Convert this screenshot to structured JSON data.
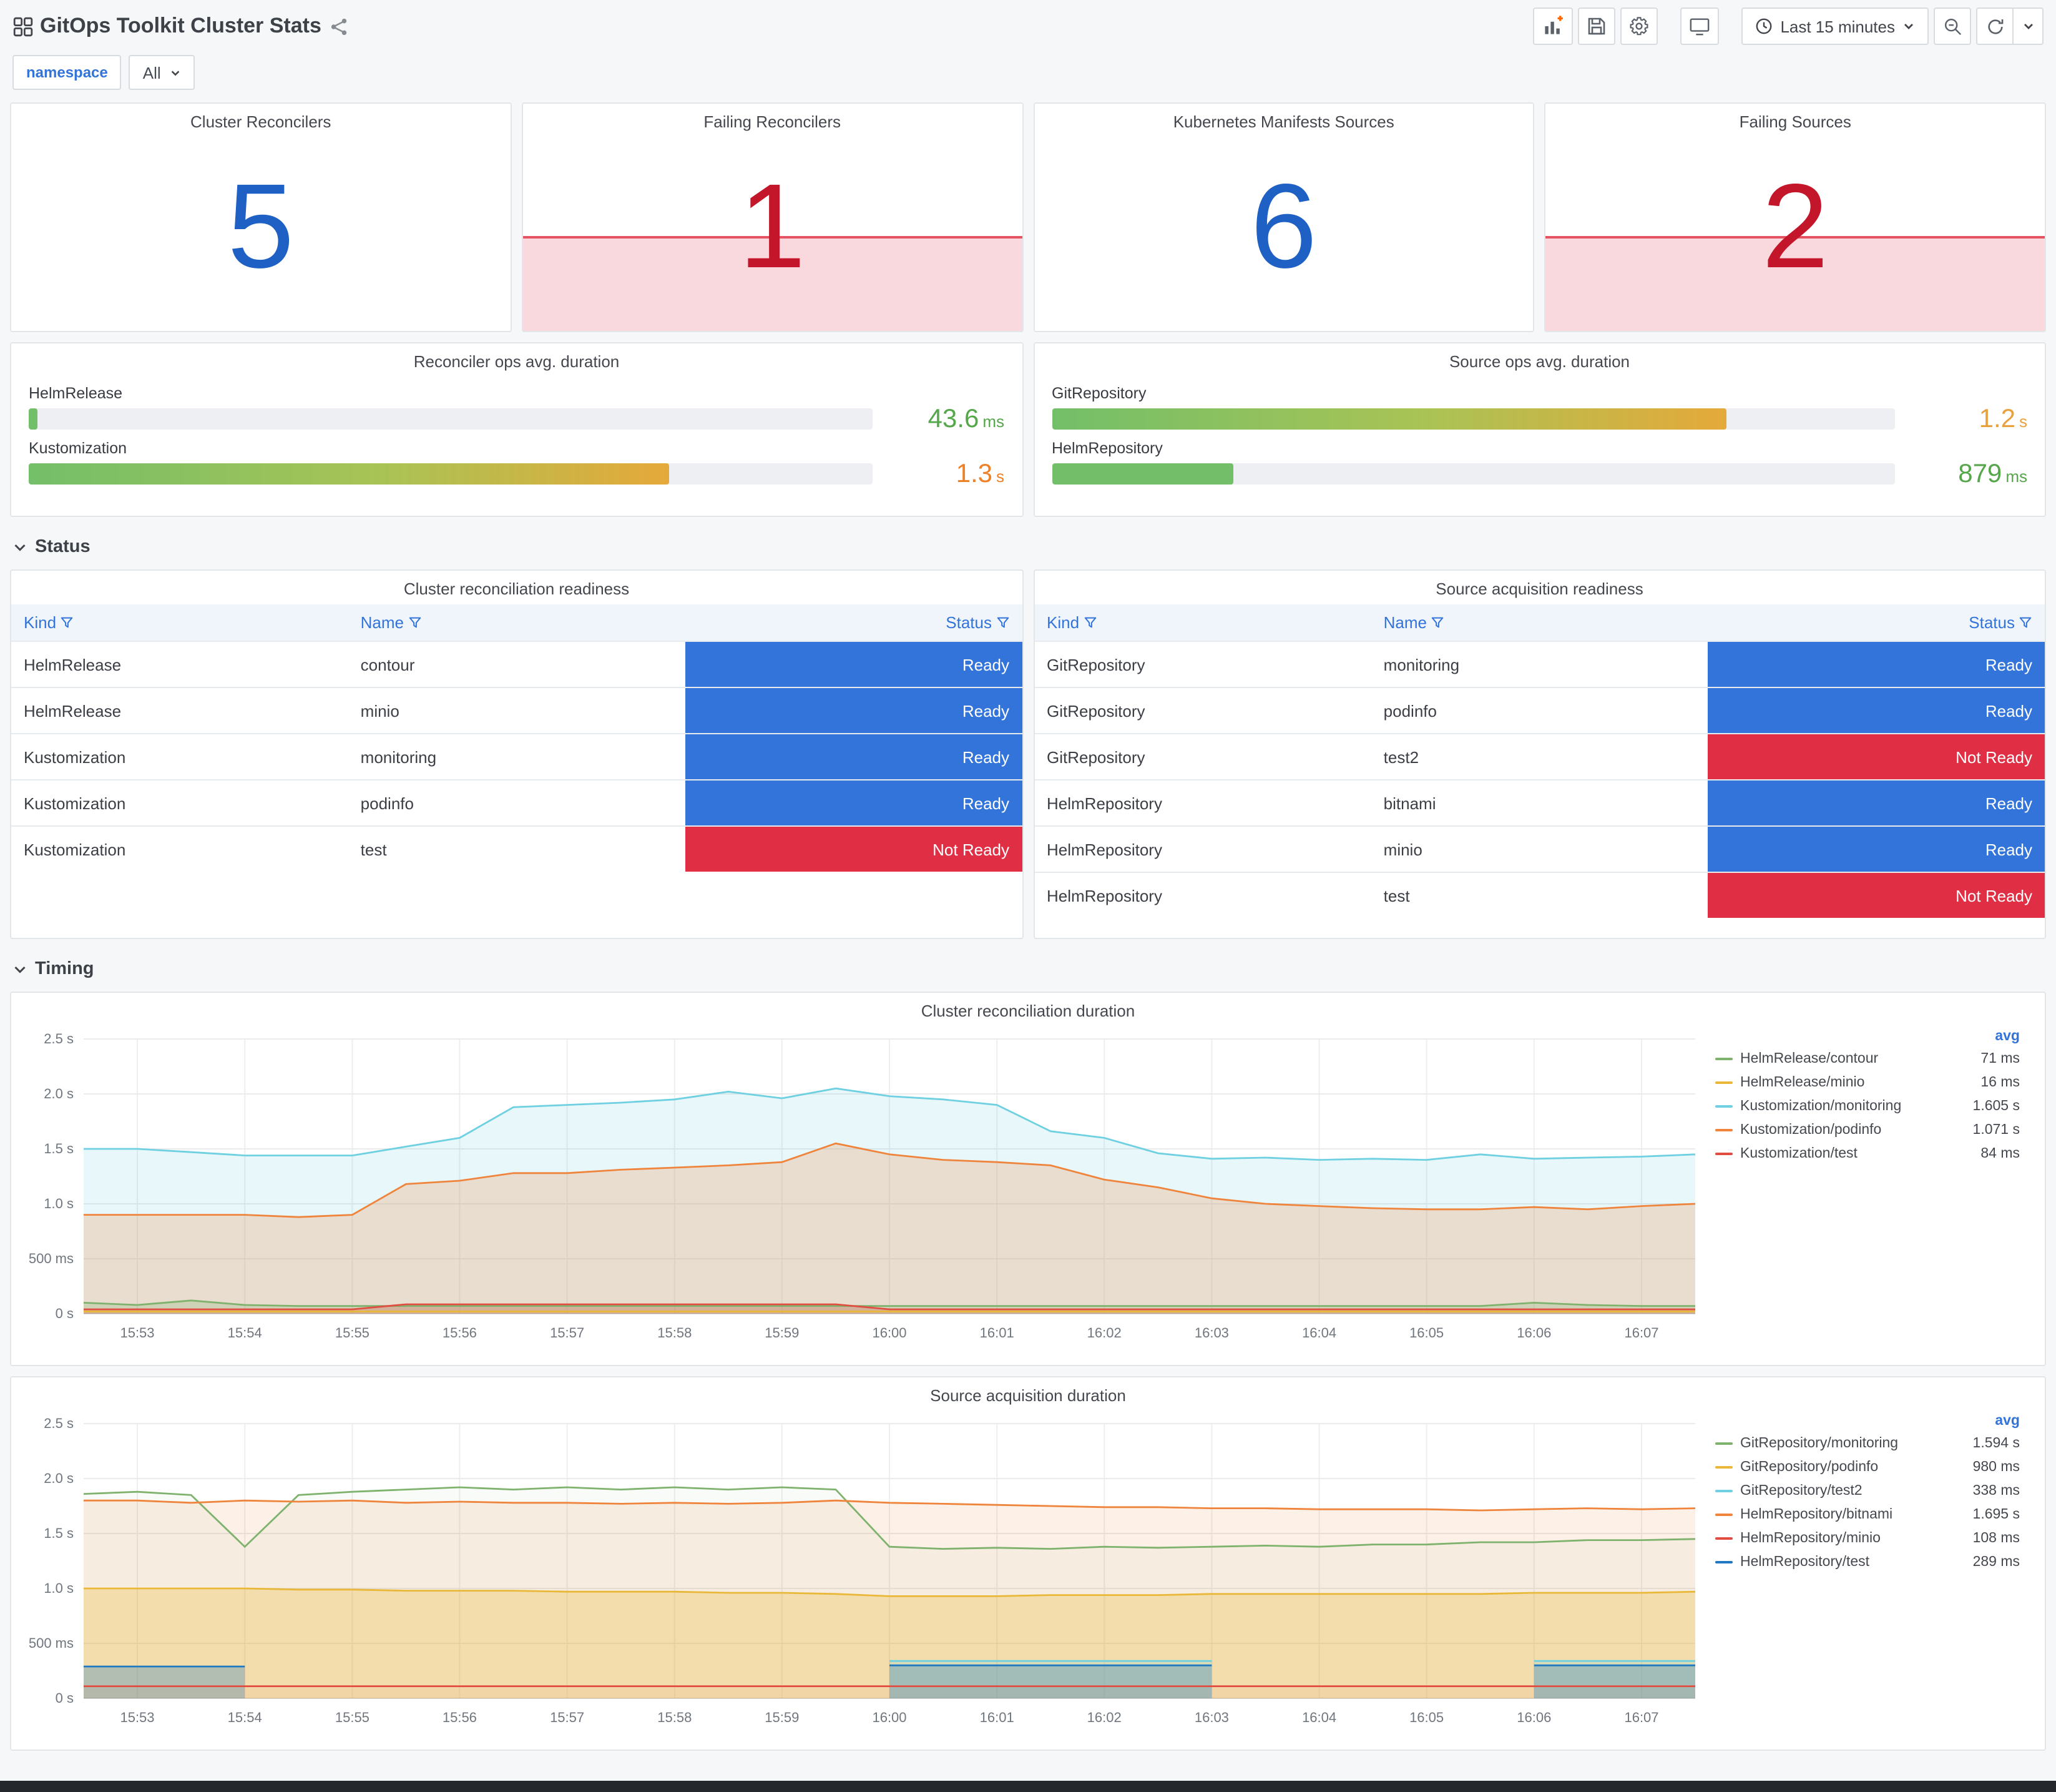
{
  "colors": {
    "stat_ok": "#1f60c4",
    "stat_alert": "#c4162a",
    "ready": "#3274d9",
    "not_ready": "#e02f44",
    "link_blue": "#3274d9",
    "gauge_green": "#73bf69"
  },
  "header": {
    "title": "GitOps Toolkit Cluster Stats",
    "icons": [
      "apps-icon",
      "share-icon"
    ],
    "toolbar": {
      "icons": [
        "add-panel-icon",
        "save-icon",
        "settings-icon",
        "tv-icon",
        "clock-icon",
        "chevron-down-icon",
        "zoom-out-icon",
        "refresh-icon"
      ],
      "time_range": "Last 15 minutes"
    }
  },
  "variables": {
    "label": "namespace",
    "value": "All"
  },
  "sections": {
    "status": "Status",
    "timing": "Timing"
  },
  "stats": [
    {
      "title": "Cluster Reconcilers",
      "value": "5",
      "state": "ok"
    },
    {
      "title": "Failing Reconcilers",
      "value": "1",
      "state": "alert"
    },
    {
      "title": "Kubernetes Manifests Sources",
      "value": "6",
      "state": "ok"
    },
    {
      "title": "Failing Sources",
      "value": "2",
      "state": "alert"
    }
  ],
  "gauges": [
    {
      "title": "Reconciler ops avg. duration",
      "rows": [
        {
          "label": "HelmRelease",
          "value": "43.6",
          "unit": "ms",
          "pct": 1,
          "grad": "grad-g",
          "color": "#56a64b"
        },
        {
          "label": "Kustomization",
          "value": "1.3",
          "unit": "s",
          "pct": 76,
          "grad": "grad-gy",
          "color": "#ed8128"
        }
      ]
    },
    {
      "title": "Source ops avg. duration",
      "rows": [
        {
          "label": "GitRepository",
          "value": "1.2",
          "unit": "s",
          "pct": 80,
          "grad": "grad-gy",
          "color": "#e8a13c"
        },
        {
          "label": "HelmRepository",
          "value": "879",
          "unit": "ms",
          "pct": 21.5,
          "grad": "grad-g",
          "color": "#56a64b"
        }
      ]
    }
  ],
  "tables": [
    {
      "title": "Cluster reconciliation readiness",
      "columns": [
        "Kind",
        "Name",
        "Status"
      ],
      "rows": [
        [
          "HelmRelease",
          "contour",
          "Ready"
        ],
        [
          "HelmRelease",
          "minio",
          "Ready"
        ],
        [
          "Kustomization",
          "monitoring",
          "Ready"
        ],
        [
          "Kustomization",
          "podinfo",
          "Ready"
        ],
        [
          "Kustomization",
          "test",
          "Not Ready"
        ]
      ]
    },
    {
      "title": "Source acquisition readiness",
      "columns": [
        "Kind",
        "Name",
        "Status"
      ],
      "rows": [
        [
          "GitRepository",
          "monitoring",
          "Ready"
        ],
        [
          "GitRepository",
          "podinfo",
          "Ready"
        ],
        [
          "GitRepository",
          "test2",
          "Not Ready"
        ],
        [
          "HelmRepository",
          "bitnami",
          "Ready"
        ],
        [
          "HelmRepository",
          "minio",
          "Ready"
        ],
        [
          "HelmRepository",
          "test",
          "Not Ready"
        ]
      ]
    }
  ],
  "chart_data": [
    {
      "type": "line",
      "title": "Cluster reconciliation duration",
      "legend_header": "avg",
      "ylim": [
        0,
        2.5
      ],
      "y_ticks": [
        [
          "0 s",
          0
        ],
        [
          "500 ms",
          0.5
        ],
        [
          "1.0 s",
          1
        ],
        [
          "1.5 s",
          1.5
        ],
        [
          "2.0 s",
          2
        ],
        [
          "2.5 s",
          2.5
        ]
      ],
      "x_ticks": [
        "15:53",
        "15:54",
        "15:55",
        "15:56",
        "15:57",
        "15:58",
        "15:59",
        "16:00",
        "16:01",
        "16:02",
        "16:03",
        "16:04",
        "16:05",
        "16:06",
        "16:07"
      ],
      "x_step_seconds": 30,
      "series": [
        {
          "name": "HelmRelease/contour",
          "color": "#7eb26d",
          "avg": "71 ms",
          "fill": 0.25,
          "values": [
            0.1,
            0.08,
            0.12,
            0.08,
            0.07,
            0.07,
            0.07,
            0.07,
            0.07,
            0.07,
            0.07,
            0.07,
            0.07,
            0.07,
            0.07,
            0.07,
            0.07,
            0.07,
            0.07,
            0.07,
            0.07,
            0.07,
            0.07,
            0.07,
            0.07,
            0.07,
            0.07,
            0.1,
            0.08,
            0.07,
            0.07
          ]
        },
        {
          "name": "HelmRelease/minio",
          "color": "#eab839",
          "avg": "16 ms",
          "fill": 0,
          "values": [
            0.02,
            0.02,
            0.02,
            0.02,
            0.02,
            0.02,
            0.02,
            0.02,
            0.02,
            0.02,
            0.02,
            0.02,
            0.02,
            0.02,
            0.02,
            0.02,
            0.02,
            0.02,
            0.02,
            0.02,
            0.02,
            0.02,
            0.02,
            0.02,
            0.02,
            0.02,
            0.02,
            0.02,
            0.02,
            0.02,
            0.02
          ]
        },
        {
          "name": "Kustomization/monitoring",
          "color": "#6ed0e0",
          "avg": "1.605 s",
          "fill": 0.16,
          "values": [
            1.5,
            1.5,
            1.47,
            1.44,
            1.44,
            1.44,
            1.52,
            1.6,
            1.88,
            1.9,
            1.92,
            1.95,
            2.02,
            1.96,
            2.05,
            1.98,
            1.95,
            1.9,
            1.66,
            1.6,
            1.46,
            1.41,
            1.42,
            1.4,
            1.41,
            1.4,
            1.45,
            1.41,
            1.42,
            1.43,
            1.45
          ]
        },
        {
          "name": "Kustomization/podinfo",
          "color": "#ef843c",
          "avg": "1.071 s",
          "fill": 0.22,
          "values": [
            0.9,
            0.9,
            0.9,
            0.9,
            0.88,
            0.9,
            1.18,
            1.21,
            1.28,
            1.28,
            1.31,
            1.33,
            1.35,
            1.38,
            1.55,
            1.45,
            1.4,
            1.38,
            1.35,
            1.22,
            1.15,
            1.05,
            1.0,
            0.98,
            0.96,
            0.95,
            0.95,
            0.97,
            0.95,
            0.98,
            1.0
          ]
        },
        {
          "name": "Kustomization/test",
          "color": "#e24d42",
          "avg": "84 ms",
          "fill": 0.25,
          "values": [
            0.04,
            0.04,
            0.04,
            0.04,
            0.04,
            0.04,
            0.085,
            0.085,
            0.085,
            0.085,
            0.085,
            0.085,
            0.085,
            0.085,
            0.085,
            0.04,
            0.04,
            0.04,
            0.04,
            0.04,
            0.04,
            0.04,
            0.04,
            0.04,
            0.04,
            0.04,
            0.04,
            0.04,
            0.04,
            0.04,
            0.04
          ]
        }
      ]
    },
    {
      "type": "line",
      "title": "Source acquisition duration",
      "legend_header": "avg",
      "ylim": [
        0,
        2.5
      ],
      "y_ticks": [
        [
          "0 s",
          0
        ],
        [
          "500 ms",
          0.5
        ],
        [
          "1.0 s",
          1
        ],
        [
          "1.5 s",
          1.5
        ],
        [
          "2.0 s",
          2
        ],
        [
          "2.5 s",
          2.5
        ]
      ],
      "x_ticks": [
        "15:53",
        "15:54",
        "15:55",
        "15:56",
        "15:57",
        "15:58",
        "15:59",
        "16:00",
        "16:01",
        "16:02",
        "16:03",
        "16:04",
        "16:05",
        "16:06",
        "16:07"
      ],
      "x_step_seconds": 30,
      "series": [
        {
          "name": "GitRepository/monitoring",
          "color": "#7eb26d",
          "avg": "1.594 s",
          "fill": 0.05,
          "values": [
            1.86,
            1.88,
            1.85,
            1.38,
            1.85,
            1.88,
            1.9,
            1.92,
            1.9,
            1.92,
            1.9,
            1.92,
            1.9,
            1.92,
            1.9,
            1.38,
            1.36,
            1.37,
            1.36,
            1.38,
            1.37,
            1.38,
            1.39,
            1.38,
            1.4,
            1.4,
            1.42,
            1.42,
            1.44,
            1.44,
            1.45
          ]
        },
        {
          "name": "GitRepository/podinfo",
          "color": "#eab839",
          "avg": "980 ms",
          "fill": 0.3,
          "values": [
            1.0,
            1.0,
            1.0,
            1.0,
            0.99,
            0.99,
            0.98,
            0.98,
            0.98,
            0.97,
            0.97,
            0.97,
            0.96,
            0.96,
            0.95,
            0.93,
            0.93,
            0.93,
            0.94,
            0.94,
            0.94,
            0.95,
            0.95,
            0.95,
            0.95,
            0.95,
            0.95,
            0.96,
            0.96,
            0.96,
            0.97
          ]
        },
        {
          "name": "GitRepository/test2",
          "color": "#6ed0e0",
          "avg": "338 ms",
          "fill": 0.18,
          "values": [
            null,
            null,
            null,
            null,
            null,
            null,
            null,
            null,
            null,
            null,
            null,
            null,
            null,
            null,
            null,
            0.34,
            0.34,
            0.34,
            0.34,
            0.34,
            0.34,
            0.34,
            null,
            null,
            null,
            null,
            null,
            0.34,
            0.34,
            0.34,
            0.34
          ]
        },
        {
          "name": "HelmRepository/bitnami",
          "color": "#ef843c",
          "avg": "1.695 s",
          "fill": 0.12,
          "values": [
            1.8,
            1.8,
            1.78,
            1.8,
            1.79,
            1.8,
            1.78,
            1.79,
            1.78,
            1.78,
            1.77,
            1.78,
            1.77,
            1.78,
            1.8,
            1.78,
            1.77,
            1.76,
            1.75,
            1.74,
            1.74,
            1.73,
            1.73,
            1.72,
            1.72,
            1.72,
            1.71,
            1.72,
            1.73,
            1.72,
            1.73
          ]
        },
        {
          "name": "HelmRepository/minio",
          "color": "#e24d42",
          "avg": "108 ms",
          "fill": 0.05,
          "values": [
            0.11,
            0.11,
            0.11,
            0.11,
            0.11,
            0.11,
            0.11,
            0.11,
            0.11,
            0.11,
            0.11,
            0.11,
            0.11,
            0.11,
            0.11,
            0.11,
            0.11,
            0.11,
            0.11,
            0.11,
            0.11,
            0.11,
            0.11,
            0.11,
            0.11,
            0.11,
            0.11,
            0.11,
            0.11,
            0.11,
            0.11
          ]
        },
        {
          "name": "HelmRepository/test",
          "color": "#1f78c1",
          "avg": "289 ms",
          "fill": 0.3,
          "values": [
            0.29,
            0.29,
            0.29,
            0.29,
            null,
            null,
            null,
            null,
            null,
            null,
            null,
            null,
            null,
            null,
            null,
            0.3,
            0.3,
            0.3,
            0.3,
            0.3,
            0.3,
            0.3,
            null,
            null,
            null,
            null,
            null,
            0.3,
            0.3,
            0.3,
            0.3
          ]
        }
      ]
    }
  ]
}
